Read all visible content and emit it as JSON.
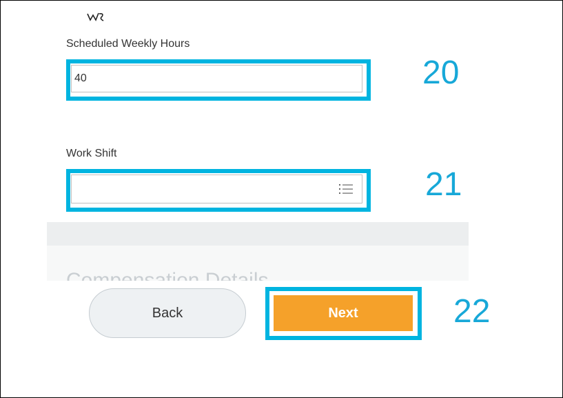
{
  "form": {
    "scheduled_weekly_hours": {
      "label": "Scheduled Weekly Hours",
      "value": "40"
    },
    "work_shift": {
      "label": "Work Shift",
      "value": "",
      "icon": "list-icon"
    },
    "next_section_title": "Compensation Details"
  },
  "callouts": {
    "hours": "20",
    "shift": "21",
    "next": "22"
  },
  "buttons": {
    "back_label": "Back",
    "next_label": "Next"
  },
  "colors": {
    "callout_border": "#00b4e0",
    "callout_number": "#17a8d8",
    "next_button": "#f5a12a",
    "back_button": "#eef1f3"
  }
}
